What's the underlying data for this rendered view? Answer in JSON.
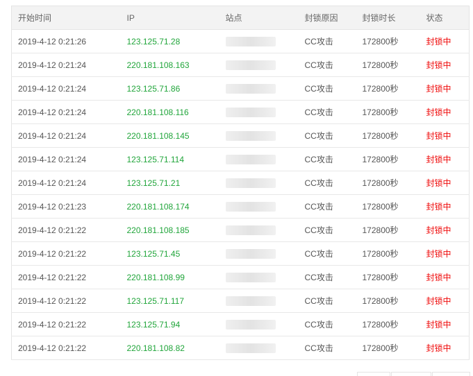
{
  "table": {
    "headers": [
      "开始时间",
      "IP",
      "站点",
      "封锁原因",
      "封锁时长",
      "状态"
    ],
    "rows": [
      {
        "time": "2019-4-12 0:21:26",
        "ip": "123.125.71.28",
        "reason": "CC攻击",
        "duration": "172800秒",
        "status": "封锁中"
      },
      {
        "time": "2019-4-12 0:21:24",
        "ip": "220.181.108.163",
        "reason": "CC攻击",
        "duration": "172800秒",
        "status": "封锁中"
      },
      {
        "time": "2019-4-12 0:21:24",
        "ip": "123.125.71.86",
        "reason": "CC攻击",
        "duration": "172800秒",
        "status": "封锁中"
      },
      {
        "time": "2019-4-12 0:21:24",
        "ip": "220.181.108.116",
        "reason": "CC攻击",
        "duration": "172800秒",
        "status": "封锁中"
      },
      {
        "time": "2019-4-12 0:21:24",
        "ip": "220.181.108.145",
        "reason": "CC攻击",
        "duration": "172800秒",
        "status": "封锁中"
      },
      {
        "time": "2019-4-12 0:21:24",
        "ip": "123.125.71.114",
        "reason": "CC攻击",
        "duration": "172800秒",
        "status": "封锁中"
      },
      {
        "time": "2019-4-12 0:21:24",
        "ip": "123.125.71.21",
        "reason": "CC攻击",
        "duration": "172800秒",
        "status": "封锁中"
      },
      {
        "time": "2019-4-12 0:21:23",
        "ip": "220.181.108.174",
        "reason": "CC攻击",
        "duration": "172800秒",
        "status": "封锁中"
      },
      {
        "time": "2019-4-12 0:21:22",
        "ip": "220.181.108.185",
        "reason": "CC攻击",
        "duration": "172800秒",
        "status": "封锁中"
      },
      {
        "time": "2019-4-12 0:21:22",
        "ip": "123.125.71.45",
        "reason": "CC攻击",
        "duration": "172800秒",
        "status": "封锁中"
      },
      {
        "time": "2019-4-12 0:21:22",
        "ip": "220.181.108.99",
        "reason": "CC攻击",
        "duration": "172800秒",
        "status": "封锁中"
      },
      {
        "time": "2019-4-12 0:21:22",
        "ip": "123.125.71.117",
        "reason": "CC攻击",
        "duration": "172800秒",
        "status": "封锁中"
      },
      {
        "time": "2019-4-12 0:21:22",
        "ip": "123.125.71.94",
        "reason": "CC攻击",
        "duration": "172800秒",
        "status": "封锁中"
      },
      {
        "time": "2019-4-12 0:21:22",
        "ip": "220.181.108.82",
        "reason": "CC攻击",
        "duration": "172800秒",
        "status": "封锁中"
      }
    ]
  },
  "colors": {
    "ip": "#20a53a",
    "status_blocked": "#ef0808",
    "header_bg": "#f3f3f3"
  }
}
